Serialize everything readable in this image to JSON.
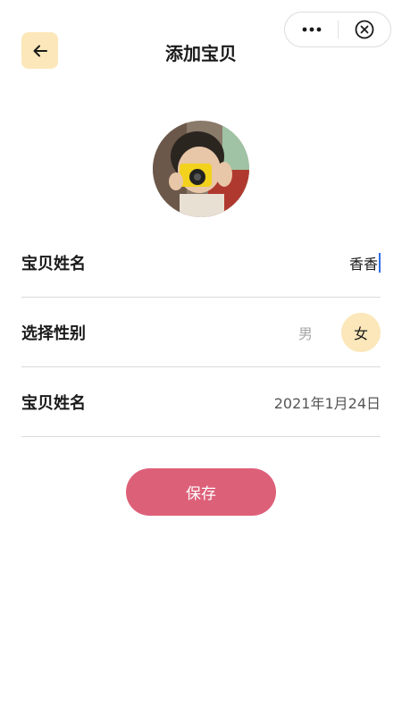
{
  "header": {
    "title": "添加宝贝",
    "back_icon": "arrow-left-icon",
    "more_icon": "more-dots-icon",
    "close_icon": "close-circle-icon"
  },
  "avatar": {
    "icon": "baby-photo-avatar"
  },
  "form": {
    "name_row": {
      "label": "宝贝姓名",
      "value": "香香"
    },
    "gender_row": {
      "label": "选择性别",
      "male": "男",
      "female": "女",
      "selected": "女"
    },
    "birth_row": {
      "label": "宝贝姓名",
      "value": "2021年1月24日"
    }
  },
  "actions": {
    "save_label": "保存"
  },
  "colors": {
    "accent_yellow": "#fbe7b9",
    "save_button": "#dd6079",
    "cursor": "#2e6ee6"
  }
}
